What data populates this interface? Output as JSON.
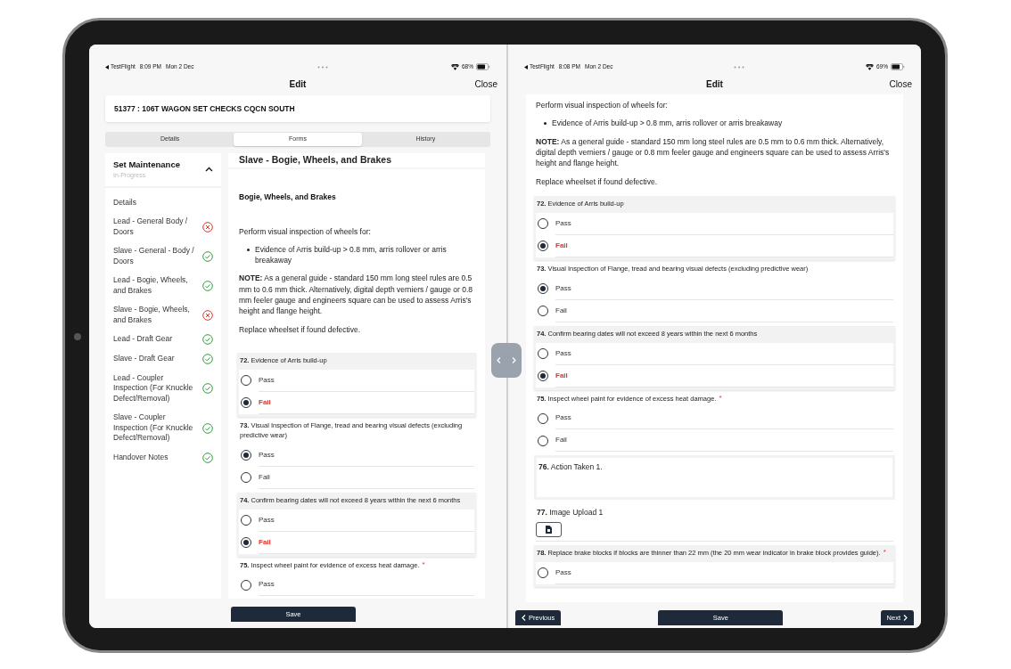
{
  "left_pane": {
    "status_bar": {
      "app": "TestFlight",
      "time": "8:09 PM",
      "date": "Mon 2 Dec",
      "battery": "68%"
    },
    "nav": {
      "title": "Edit",
      "action": "Close"
    },
    "job_title": "51377 : 106T WAGON SET CHECKS CQCN SOUTH",
    "tabs": [
      {
        "label": "Details",
        "selected": false
      },
      {
        "label": "Forms",
        "selected": true
      },
      {
        "label": "History",
        "selected": false
      }
    ],
    "sidebar": {
      "title": "Set Maintenance",
      "status": "In-Progress",
      "expanded": true,
      "items": [
        {
          "label": "Details",
          "kind": "plain"
        },
        {
          "label": "Lead - General Body / Doors",
          "kind": "fail"
        },
        {
          "label": "Slave - General - Body / Doors",
          "kind": "pass"
        },
        {
          "label": "Lead - Bogie, Wheels, and Brakes",
          "kind": "pass"
        },
        {
          "label": "Slave - Bogie, Wheels, and Brakes",
          "kind": "fail"
        },
        {
          "label": "Lead - Draft Gear",
          "kind": "pass"
        },
        {
          "label": "Slave - Draft Gear",
          "kind": "pass"
        },
        {
          "label": "Lead - Coupler Inspection (For Knuckle Defect/Removal)",
          "kind": "pass"
        },
        {
          "label": "Slave - Coupler Inspection (For Knuckle Defect/Removal)",
          "kind": "pass"
        },
        {
          "label": "Handover Notes",
          "kind": "pass"
        }
      ]
    },
    "form": {
      "title": "Slave - Bogie, Wheels, and Brakes",
      "section": "Bogie, Wheels, and Brakes",
      "intro": "Perform visual inspection of wheels for:",
      "bullets": [
        "Evidence of Arris build-up > 0.8 mm, arris rollover or arris breakaway"
      ],
      "note": "**NOTE:** As a general guide - standard 150 mm long steel rules are 0.5 mm to 0.6 mm thick. Alternatively, digital depth verniers / gauge or 0.8 mm feeler gauge and engineers square can be used to assess Arris's height and flange height.",
      "closing": "Replace wheelset if found defective.",
      "questions": [
        {
          "kind": "radio",
          "number": "72.",
          "text": "Evidence of Arris build-up",
          "options": [
            {
              "label": "Pass",
              "selected": false
            },
            {
              "label": "Fail",
              "selected": true,
              "color": "#e0362c"
            }
          ]
        },
        {
          "kind": "radio",
          "number": "73.",
          "text": "Visual Inspection of Flange, tread and bearing visual defects (excluding predictive wear)",
          "options": [
            {
              "label": "Pass",
              "selected": true
            },
            {
              "label": "Fail",
              "selected": false
            }
          ]
        },
        {
          "kind": "radio",
          "number": "74.",
          "text": "Confirm bearing dates will not exceed 8 years within the next 6 months",
          "options": [
            {
              "label": "Pass",
              "selected": false
            },
            {
              "label": "Fail",
              "selected": true,
              "color": "#e0362c"
            }
          ]
        },
        {
          "kind": "radio",
          "number": "75.",
          "text": "Inspect wheel paint for evidence of excess heat damage.",
          "required_mark": "*",
          "options": [
            {
              "label": "Pass",
              "selected": false
            }
          ]
        }
      ]
    },
    "buttons": [
      {
        "kind": "save",
        "label": "Save"
      }
    ]
  },
  "right_pane": {
    "status_bar": {
      "app": "TestFlight",
      "time": "8:08 PM",
      "date": "Mon 2 Dec",
      "battery": "69%"
    },
    "nav": {
      "title": "Edit",
      "action": "Close"
    },
    "form": {
      "intro": "Perform visual inspection of wheels for:",
      "bullets": [
        "Evidence of Arris build-up > 0.8 mm, arris rollover or arris breakaway"
      ],
      "note": "**NOTE:** As a general guide - standard 150 mm long steel rules are 0.5 mm to 0.6 mm thick. Alternatively, digital depth verniers / gauge or 0.8 mm feeler gauge and engineers square can be used to assess Arris's height and flange height.",
      "closing": "Replace wheelset if found defective.",
      "questions": [
        {
          "kind": "radio",
          "number": "72.",
          "text": "Evidence of Arris build-up",
          "options": [
            {
              "label": "Pass",
              "selected": false
            },
            {
              "label": "Fail",
              "selected": true,
              "color": "#e0362c"
            }
          ]
        },
        {
          "kind": "radio",
          "number": "73.",
          "text": "Visual Inspection of Flange, tread and bearing visual defects (excluding predictive wear)",
          "options": [
            {
              "label": "Pass",
              "selected": true
            },
            {
              "label": "Fail",
              "selected": false
            }
          ]
        },
        {
          "kind": "radio",
          "number": "74.",
          "text": "Confirm bearing dates will not exceed 8 years within the next 6 months",
          "options": [
            {
              "label": "Pass",
              "selected": false
            },
            {
              "label": "Fail",
              "selected": true,
              "color": "#e0362c"
            }
          ]
        },
        {
          "kind": "radio",
          "number": "75.",
          "text": "Inspect wheel paint for evidence of excess heat damage.",
          "required_mark": "*",
          "options": [
            {
              "label": "Pass",
              "selected": false
            },
            {
              "label": "Fail",
              "selected": false
            }
          ]
        },
        {
          "kind": "text",
          "number": "76.",
          "text": "Action Taken 1."
        },
        {
          "kind": "upload",
          "number": "77.",
          "text": "Image Upload 1"
        },
        {
          "kind": "radio",
          "number": "78.",
          "text": "Replace brake blocks if blocks are thinner than 22 mm (the 20 mm wear indicator in brake block provides guide).",
          "required_mark": "*",
          "options": [
            {
              "label": "Pass",
              "selected": false
            }
          ]
        }
      ]
    },
    "buttons": [
      {
        "kind": "previous",
        "label": "Previous"
      },
      {
        "kind": "save",
        "label": "Save"
      },
      {
        "kind": "next",
        "label": "Next"
      }
    ]
  }
}
